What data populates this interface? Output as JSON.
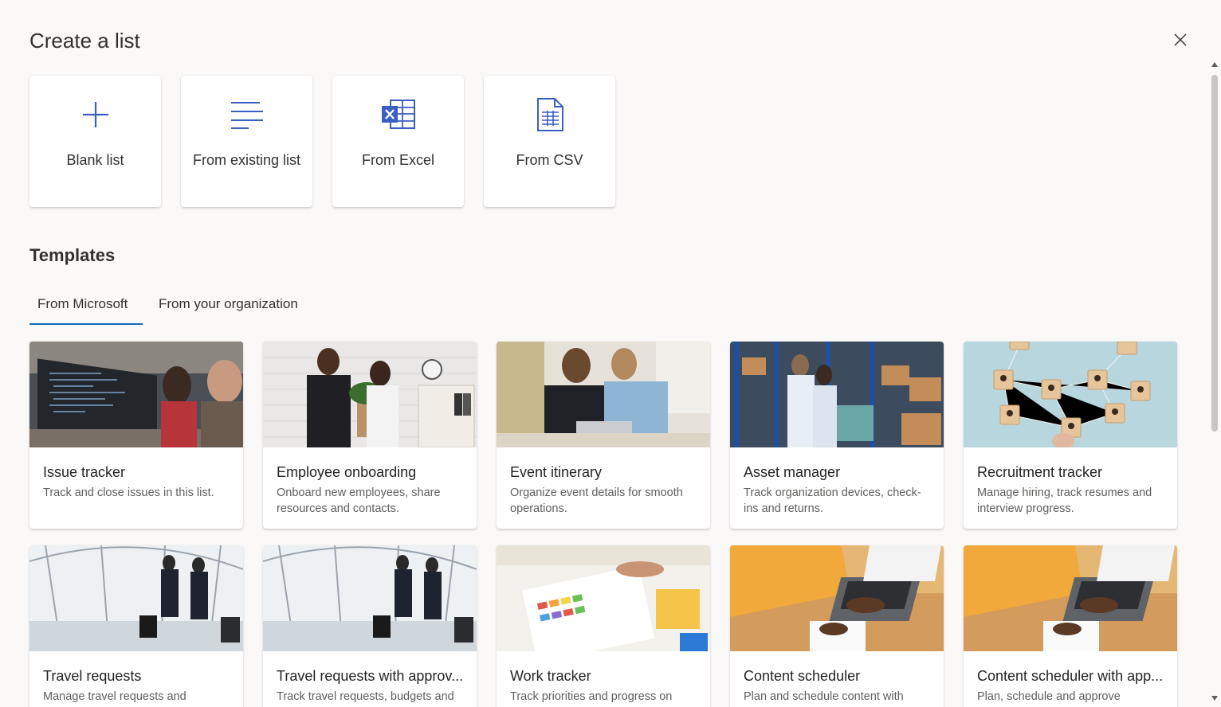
{
  "dialog": {
    "title": "Create a list",
    "close_icon": "close-icon"
  },
  "create_options": [
    {
      "label": "Blank list",
      "icon": "plus-icon"
    },
    {
      "label": "From existing list",
      "icon": "lines-icon"
    },
    {
      "label": "From Excel",
      "icon": "excel-icon"
    },
    {
      "label": "From CSV",
      "icon": "csv-file-icon"
    }
  ],
  "templates": {
    "heading": "Templates",
    "tabs": [
      {
        "label": "From Microsoft",
        "active": true
      },
      {
        "label": "From your organization",
        "active": false
      }
    ],
    "items": [
      {
        "title": "Issue tracker",
        "description": "Track and close issues in this list."
      },
      {
        "title": "Employee onboarding",
        "description": "Onboard new employees, share resources and contacts."
      },
      {
        "title": "Event itinerary",
        "description": "Organize event details for smooth operations."
      },
      {
        "title": "Asset manager",
        "description": "Track organization devices, check-ins and returns."
      },
      {
        "title": "Recruitment tracker",
        "description": "Manage hiring, track resumes and interview progress."
      },
      {
        "title": "Travel requests",
        "description": "Manage travel requests and"
      },
      {
        "title": "Travel requests with approv...",
        "description": "Track travel requests, budgets and"
      },
      {
        "title": "Work tracker",
        "description": "Track priorities and progress on"
      },
      {
        "title": "Content scheduler",
        "description": "Plan and schedule content with"
      },
      {
        "title": "Content scheduler with app...",
        "description": "Plan, schedule and approve"
      }
    ]
  },
  "colors": {
    "accent": "#0f6cbd",
    "icon_blue": "#3b5fc0",
    "background": "#faf9f8"
  }
}
